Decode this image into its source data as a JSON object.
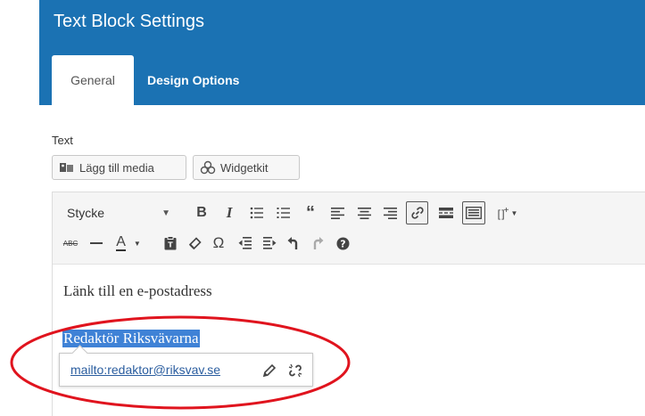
{
  "dialog": {
    "title": "Text Block Settings",
    "tabs": [
      {
        "label": "General",
        "active": true
      },
      {
        "label": "Design Options",
        "active": false
      }
    ]
  },
  "field": {
    "label": "Text"
  },
  "media_buttons": {
    "add_media": "Lägg till media",
    "widgetkit": "Widgetkit"
  },
  "toolbar": {
    "format_select": "Stycke",
    "row1_icons": [
      "bold-icon",
      "italic-icon",
      "bullet-list-icon",
      "numbered-list-icon",
      "blockquote-icon",
      "align-left-icon",
      "align-center-icon",
      "align-right-icon",
      "link-icon",
      "read-more-icon",
      "toolbar-toggle-icon",
      "shortcode-icon"
    ],
    "row2_icons": [
      "strikethrough-icon",
      "horizontal-line-icon",
      "text-color-icon",
      "paste-text-icon",
      "clear-formatting-icon",
      "special-character-icon",
      "outdent-icon",
      "indent-icon",
      "undo-icon",
      "redo-icon",
      "help-icon"
    ],
    "bold": "B",
    "italic": "I",
    "strikethrough": "ABC",
    "text_color": "A",
    "omega": "Ω"
  },
  "content": {
    "paragraph": "Länk till en e-postadress",
    "selected_text": "Redaktör Riksvävarna"
  },
  "link_popup": {
    "url": "mailto:redaktor@riksvav.se"
  },
  "colors": {
    "header": "#1b72b3",
    "selection": "#3f82d6",
    "annotation": "#e0141e"
  }
}
